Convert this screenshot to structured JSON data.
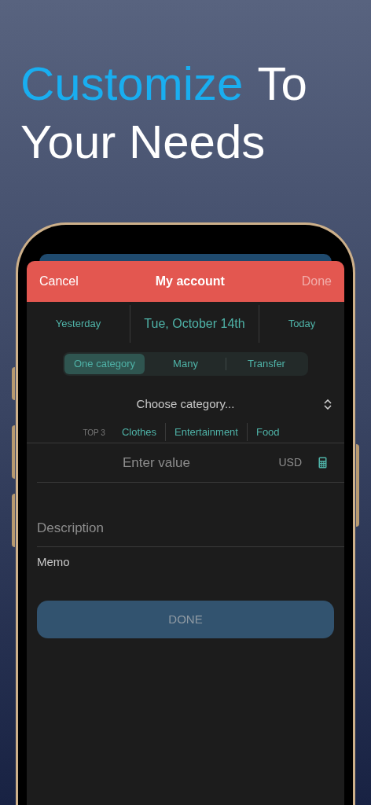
{
  "headline": {
    "lines": [
      [
        {
          "text": "Customize",
          "highlight": true
        },
        {
          "text": "To",
          "highlight": false
        }
      ],
      [
        {
          "text": "Your Needs",
          "highlight": false
        }
      ]
    ]
  },
  "header": {
    "cancel": "Cancel",
    "title": "My account",
    "done": {
      "label": "Done",
      "disabled": true
    }
  },
  "date_row": {
    "previous": "Yesterday",
    "current": "Tue, October 14th",
    "next": "Today"
  },
  "modes": [
    {
      "label": "One category",
      "selected": true
    },
    {
      "label": "Many",
      "selected": false
    },
    {
      "label": "Transfer",
      "selected": false
    }
  ],
  "category_picker": {
    "placeholder": "Choose category..."
  },
  "top_categories": {
    "label": "TOP 3",
    "items": [
      "Clothes",
      "Entertainment",
      "Food"
    ]
  },
  "amount": {
    "placeholder": "Enter value",
    "currency": "USD"
  },
  "description": {
    "placeholder": "Description"
  },
  "memo": "Memo",
  "done_button": {
    "label": "DONE",
    "disabled": true
  }
}
